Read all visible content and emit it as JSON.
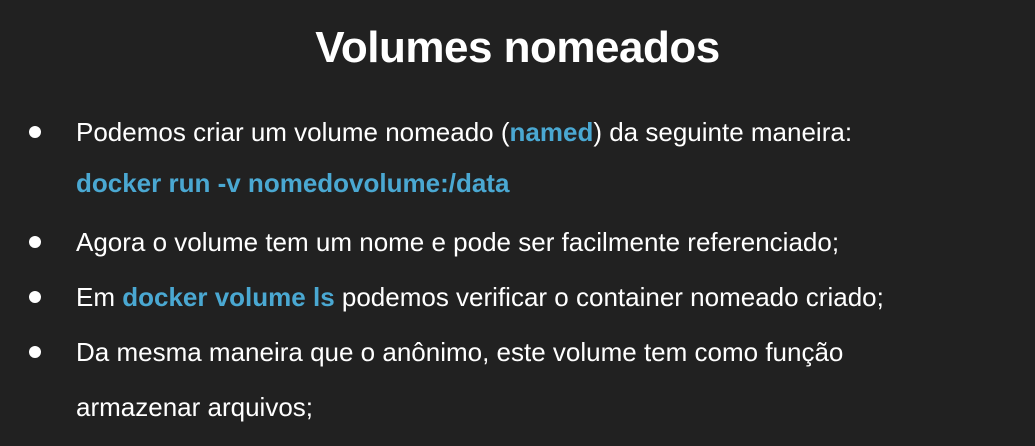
{
  "slide": {
    "title": "Volumes nomeados",
    "bullets": [
      {
        "pre": "Podemos criar um volume nomeado (",
        "highlight": "named",
        "post": ") da seguinte maneira:",
        "command": "docker run -v nomedovolume:/data"
      },
      {
        "text": "Agora o volume tem um nome  e pode ser facilmente referenciado;"
      },
      {
        "pre": "Em ",
        "highlight": "docker volume ls",
        "post": " podemos verificar o container nomeado criado;"
      },
      {
        "line1": "Da mesma maneira que o anônimo, este volume tem como função",
        "line2": "armazenar arquivos;"
      }
    ],
    "colors": {
      "background": "#212121",
      "text": "#ffffff",
      "highlight": "#4aa8d2"
    }
  }
}
